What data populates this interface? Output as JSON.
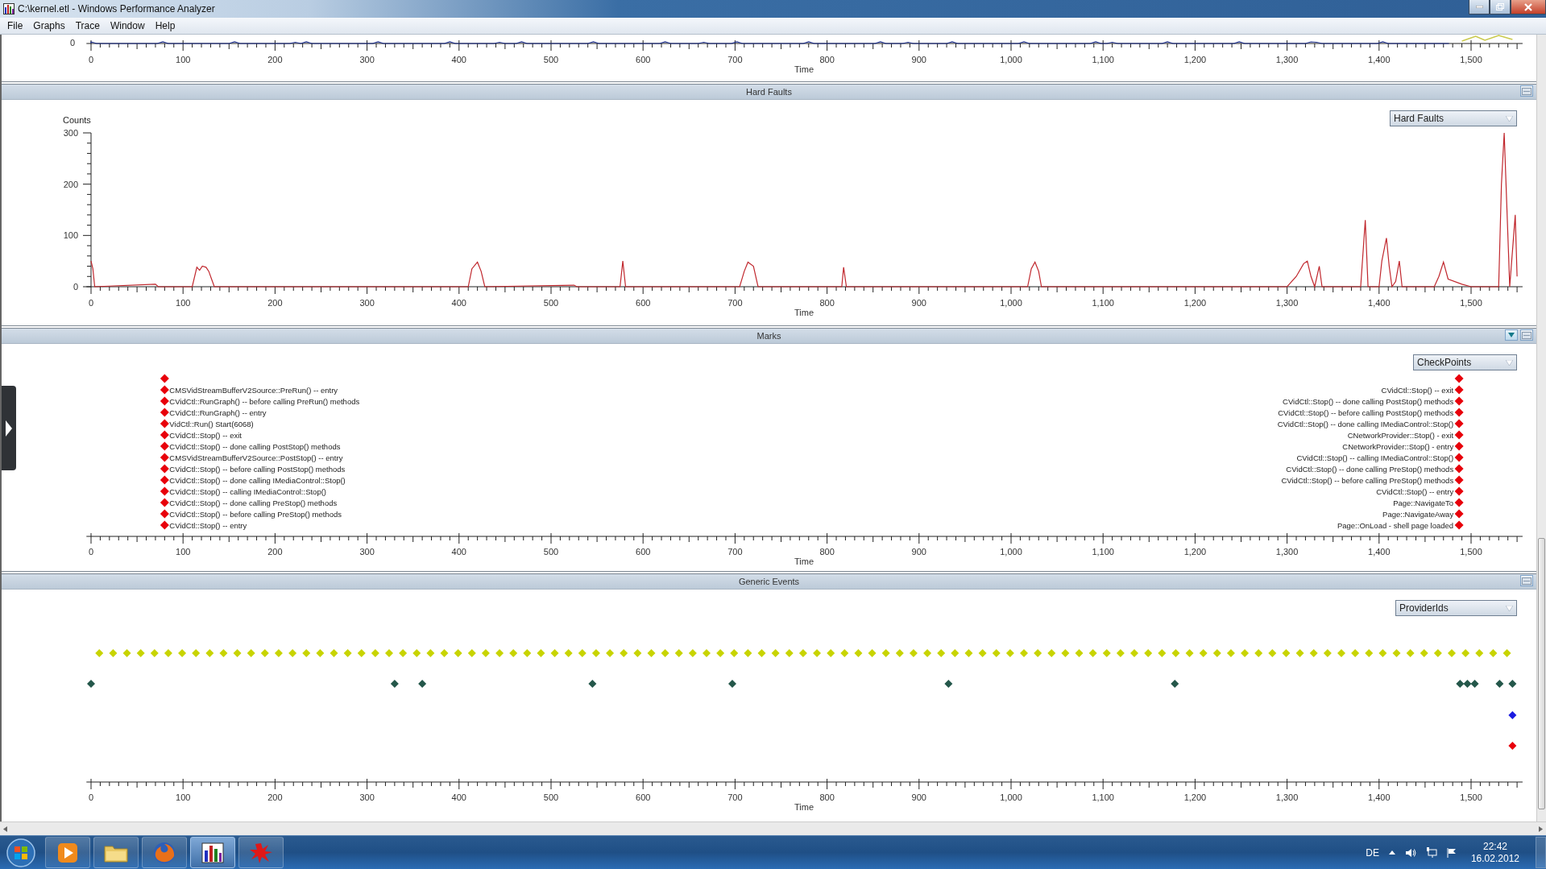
{
  "window": {
    "title": "C:\\kernel.etl - Windows Performance Analyzer"
  },
  "menu": [
    "File",
    "Graphs",
    "Trace",
    "Window",
    "Help"
  ],
  "graphs": [
    {
      "kind": "partial",
      "y_label": "0",
      "axis": {
        "ticks": [
          "0",
          "100",
          "200",
          "300",
          "400",
          "500",
          "600",
          "700",
          "800",
          "900",
          "1,000",
          "1,100",
          "1,200",
          "1,300",
          "1,400",
          "1,500"
        ],
        "title": "Time"
      }
    },
    {
      "kind": "hard_faults",
      "title": "Hard Faults",
      "dropdown": "Hard Faults",
      "chart_data": {
        "type": "line",
        "xlabel": "Time",
        "ylabel": "Counts",
        "xlim": [
          0,
          1550
        ],
        "ylim": [
          0,
          300
        ],
        "xticks": [
          {
            "value": 0,
            "label": "0"
          },
          {
            "value": 100,
            "label": "100"
          },
          {
            "value": 200,
            "label": "200"
          },
          {
            "value": 300,
            "label": "300"
          },
          {
            "value": 400,
            "label": "400"
          },
          {
            "value": 500,
            "label": "500"
          },
          {
            "value": 600,
            "label": "600"
          },
          {
            "value": 700,
            "label": "700"
          },
          {
            "value": 800,
            "label": "800"
          },
          {
            "value": 900,
            "label": "900"
          },
          {
            "value": 1000,
            "label": "1,000"
          },
          {
            "value": 1100,
            "label": "1,100"
          },
          {
            "value": 1200,
            "label": "1,200"
          },
          {
            "value": 1300,
            "label": "1,300"
          },
          {
            "value": 1400,
            "label": "1,400"
          },
          {
            "value": 1500,
            "label": "1,500"
          }
        ],
        "yticks": [
          0,
          100,
          200,
          300
        ],
        "x": [
          0,
          2,
          4,
          70,
          73,
          110,
          115,
          118,
          121,
          125,
          128,
          131,
          134,
          410,
          414,
          420,
          424,
          428,
          525,
          528,
          575,
          578,
          581,
          705,
          710,
          714,
          720,
          725,
          816,
          818,
          821,
          1018,
          1022,
          1026,
          1030,
          1033,
          1300,
          1310,
          1318,
          1322,
          1326,
          1330,
          1335,
          1338,
          1380,
          1385,
          1388,
          1400,
          1403,
          1408,
          1411,
          1414,
          1418,
          1422,
          1425,
          1460,
          1465,
          1470,
          1475,
          1490,
          1500,
          1530,
          1533,
          1536,
          1539,
          1542,
          1548,
          1550
        ],
        "series": [
          {
            "color": "#c0272d",
            "values": [
              50,
              35,
              0,
              5,
              0,
              0,
              38,
              32,
              40,
              38,
              30,
              15,
              0,
              0,
              35,
              48,
              30,
              0,
              3,
              0,
              0,
              50,
              0,
              0,
              30,
              48,
              40,
              0,
              0,
              38,
              0,
              0,
              35,
              48,
              30,
              0,
              0,
              20,
              45,
              50,
              20,
              0,
              40,
              0,
              0,
              130,
              0,
              0,
              50,
              95,
              40,
              0,
              10,
              50,
              0,
              0,
              20,
              48,
              15,
              5,
              0,
              0,
              200,
              300,
              150,
              0,
              140,
              20
            ]
          }
        ]
      }
    },
    {
      "kind": "marks",
      "title": "Marks",
      "dropdown": "CheckPoints",
      "axis": {
        "ticks": [
          "0",
          "100",
          "200",
          "300",
          "400",
          "500",
          "600",
          "700",
          "800",
          "900",
          "1,000",
          "1,100",
          "1,200",
          "1,300",
          "1,400",
          "1,500"
        ],
        "title": "Time"
      },
      "left_marks": [
        "CMSVidStreamBufferV2Source::PreRun() -- entry",
        "CVidCtl::RunGraph() -- before calling PreRun() methods",
        "CVidCtl::RunGraph() -- entry",
        "VidCtl::Run() Start(6068)",
        "CVidCtl::Stop() -- exit",
        "CVidCtl::Stop() -- done calling PostStop() methods",
        "CMSVidStreamBufferV2Source::PostStop() -- entry",
        "CVidCtl::Stop() -- before calling PostStop() methods",
        "CVidCtl::Stop() -- done calling IMediaControl::Stop()",
        "CVidCtl::Stop() -- calling IMediaControl::Stop()",
        "CVidCtl::Stop() -- done calling PreStop() methods",
        "CVidCtl::Stop() -- before calling PreStop() methods",
        "CVidCtl::Stop() -- entry"
      ],
      "right_marks": [
        "CVidCtl::Stop() -- exit",
        "CVidCtl::Stop() -- done calling PostStop() methods",
        "CVidCtl::Stop() -- before calling PostStop() methods",
        "CVidCtl::Stop() -- done calling IMediaControl::Stop()",
        "CNetworkProvider::Stop() - exit",
        "CNetworkProvider::Stop() - entry",
        "CVidCtl::Stop() -- calling IMediaControl::Stop()",
        "CVidCtl::Stop() -- done calling PreStop() methods",
        "CVidCtl::Stop() -- before calling PreStop() methods",
        "CVidCtl::Stop() -- entry",
        "Page::NavigateTo",
        "Page::NavigateAway",
        "Page::OnLoad - shell page loaded"
      ]
    },
    {
      "kind": "events",
      "title": "Generic Events",
      "dropdown": "ProviderIds",
      "axis": {
        "ticks": [
          "0",
          "100",
          "200",
          "300",
          "400",
          "500",
          "600",
          "700",
          "800",
          "900",
          "1,000",
          "1,100",
          "1,200",
          "1,300",
          "1,400",
          "1,500"
        ],
        "title": "Time"
      }
    }
  ],
  "taskbar": {
    "apps": [
      {
        "kind": "media",
        "selected": false
      },
      {
        "kind": "folder",
        "selected": false
      },
      {
        "kind": "browser",
        "selected": false
      },
      {
        "kind": "analyzer",
        "selected": true
      },
      {
        "kind": "splat",
        "selected": false
      }
    ],
    "language": "DE",
    "time": "22:42",
    "date": "16.02.2012"
  }
}
